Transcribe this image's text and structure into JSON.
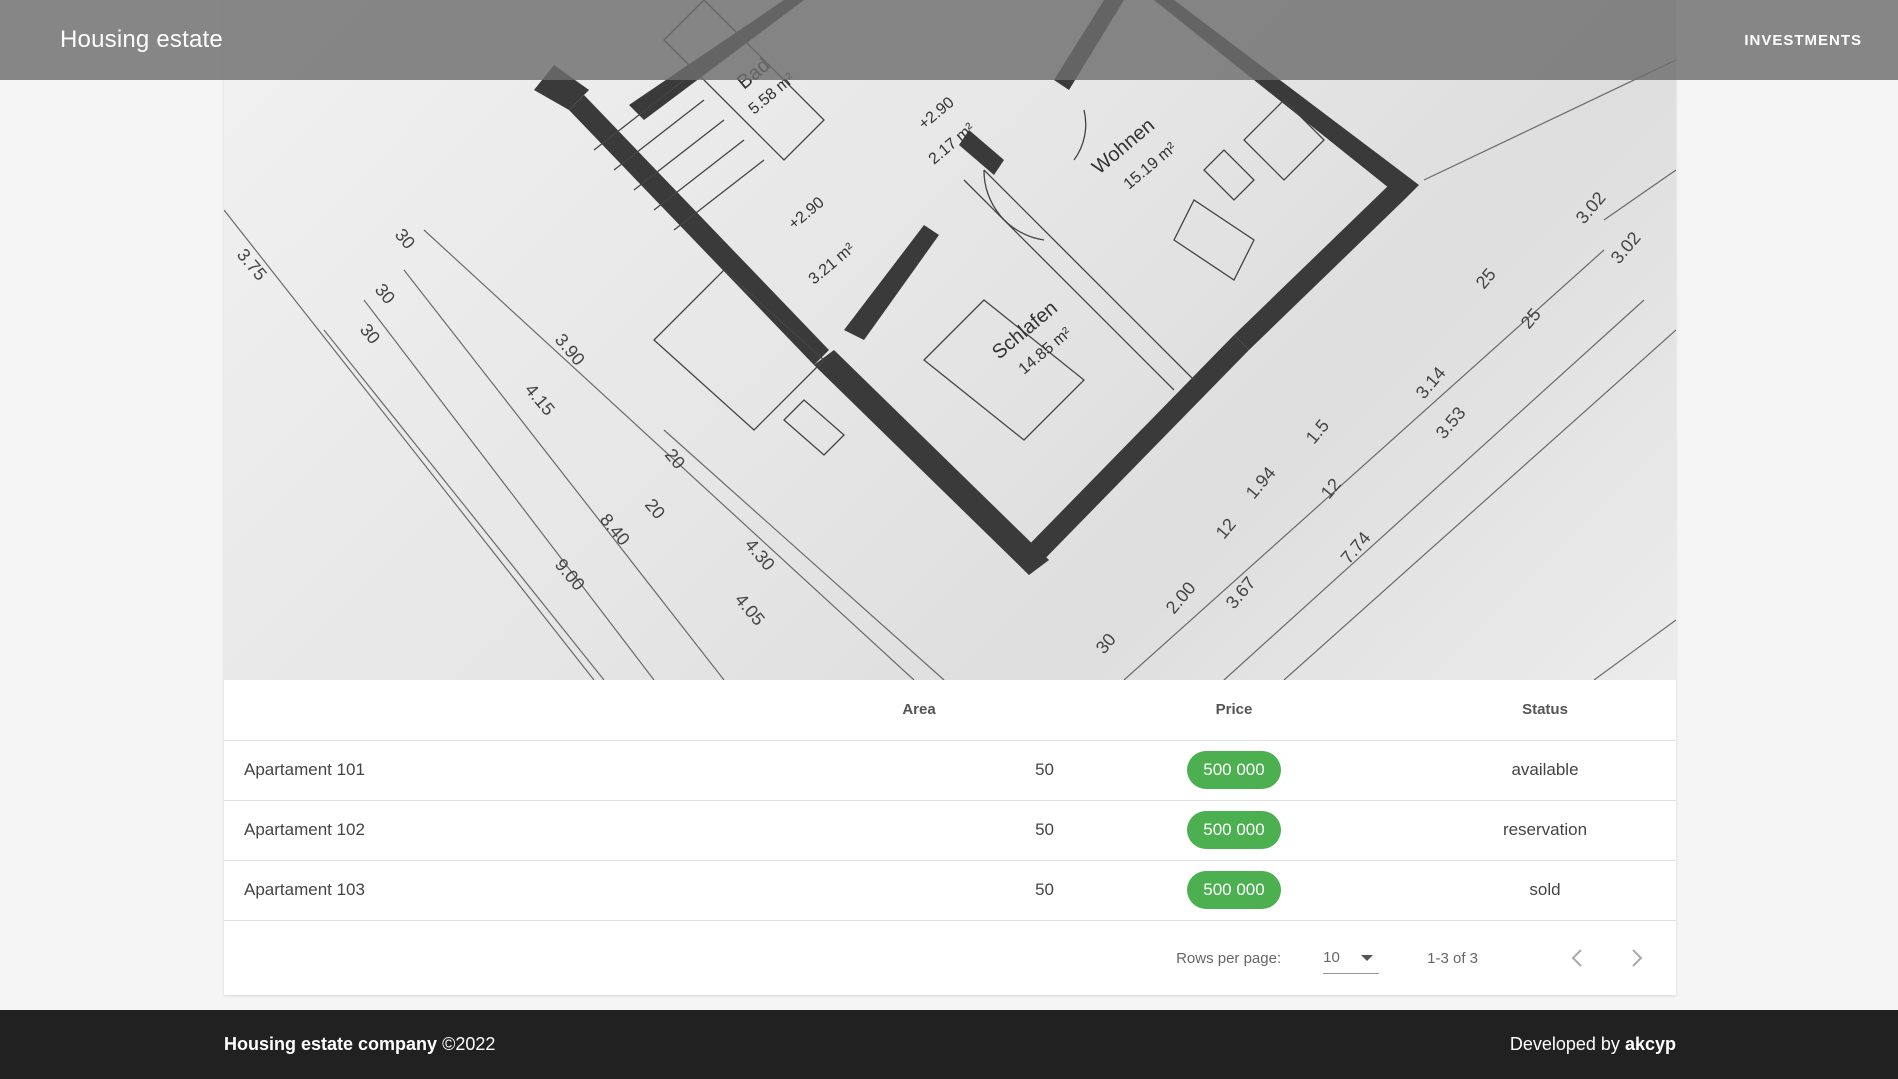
{
  "header": {
    "title": "Housing estate",
    "nav_investments": "INVESTMENTS"
  },
  "table": {
    "columns": [
      "",
      "Area",
      "Price",
      "Status"
    ],
    "rows": [
      {
        "name": "Apartament 101",
        "area": "50",
        "price": "500 000",
        "status": "available"
      },
      {
        "name": "Apartament 102",
        "area": "50",
        "price": "500 000",
        "status": "reservation"
      },
      {
        "name": "Apartament 103",
        "area": "50",
        "price": "500 000",
        "status": "sold"
      }
    ]
  },
  "pagination": {
    "rows_per_page_label": "Rows per page:",
    "rows_per_page_value": "10",
    "range_text": "1-3 of 3"
  },
  "footer": {
    "company": "Housing estate company",
    "copyright": "©2022",
    "developed_by_label": "Developed by",
    "developer": "akcyp"
  },
  "hero": {
    "labels": {
      "bad": "Bad",
      "bad_area": "5.58 m²",
      "hall_level": "+2.90",
      "hall_area": "2.17 m²",
      "stair_level": "+2.90",
      "stair_area": "3.21 m²",
      "wohnen": "Wohnen",
      "wohnen_area": "15.19 m²",
      "schlafen": "Schlafen",
      "schlafen_area": "14.85 m²"
    },
    "dimensions": [
      "3.75",
      "30",
      "30",
      "30",
      "3.90",
      "4.15",
      "20",
      "20",
      "8.40",
      "9.00",
      "4.30",
      "4.05",
      "2.00",
      "12",
      "1.94",
      "3.67",
      "12",
      "7.74",
      "3.14",
      "3.53",
      "25",
      "25",
      "3.02",
      "3.02",
      "30",
      "1.5"
    ]
  },
  "colors": {
    "accent": "#4caf50",
    "available": "#2e9b2e",
    "reservation": "#f5a623",
    "sold": "#e53935",
    "footer_bg": "#212121"
  }
}
